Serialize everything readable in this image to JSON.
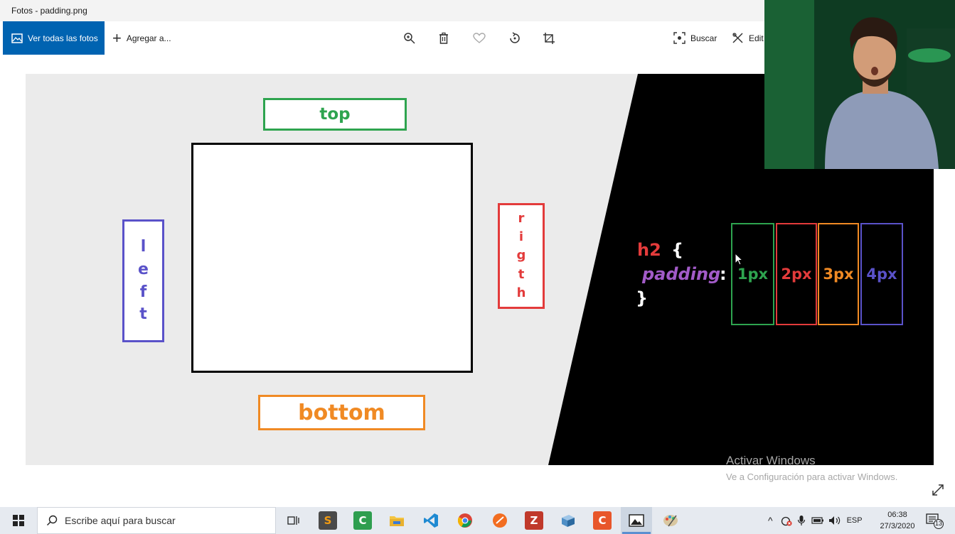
{
  "window": {
    "title": "Fotos - padding.png"
  },
  "toolbar": {
    "view_all_label": "Ver todas las fotos",
    "add_to_label": "Agregar a...",
    "search_label": "Buscar",
    "edit_label": "Edit"
  },
  "slide": {
    "labels": {
      "top": "top",
      "bottom": "bottom",
      "left": [
        "l",
        "e",
        "f",
        "t"
      ],
      "right": [
        "r",
        "i",
        "g",
        "t",
        "h"
      ]
    },
    "code": {
      "selector": "h2",
      "brace_open": "{",
      "property": "padding",
      "colon": ":",
      "brace_close": "}",
      "values": [
        "1px",
        "2px",
        "3px",
        "4px"
      ]
    },
    "colors": {
      "green": "#2ea44f",
      "red": "#e33b3b",
      "orange": "#f08a24",
      "purple": "#5a52c9",
      "property": "#a25bc8"
    }
  },
  "watermark": {
    "title": "Activar Windows",
    "subtitle": "Ve a Configuración para activar Windows."
  },
  "taskbar": {
    "search_placeholder": "Escribe aquí para buscar",
    "apps": [
      "task-view",
      "sublime-text",
      "camtasia",
      "file-explorer",
      "vscode",
      "chrome",
      "brave",
      "filezilla",
      "virtualbox",
      "camtasia-recorder",
      "photos",
      "paint"
    ],
    "language": "ESP",
    "time": "06:38",
    "date": "27/3/2020",
    "notification_count": "13"
  }
}
